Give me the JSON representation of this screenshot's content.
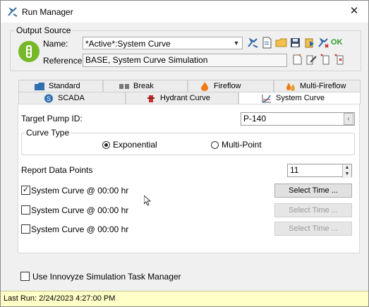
{
  "window": {
    "title": "Run Manager",
    "close_glyph": "✕"
  },
  "output_source": {
    "group_label": "Output Source",
    "name_label": "Name:",
    "name_value": "*Active*:System Curve",
    "reference_label": "Reference:",
    "reference_value": "BASE, System Curve Simulation",
    "ok_label": "OK"
  },
  "tabs": {
    "row1": [
      {
        "label": "Standard",
        "icon": "folder-icon"
      },
      {
        "label": "Break",
        "icon": "pipe-break-icon"
      },
      {
        "label": "Fireflow",
        "icon": "flame-icon"
      },
      {
        "label": "Multi-Fireflow",
        "icon": "multi-flame-icon"
      }
    ],
    "row2": [
      {
        "label": "SCADA",
        "icon": "scada-icon"
      },
      {
        "label": "Hydrant Curve",
        "icon": "hydrant-icon"
      },
      {
        "label": "System Curve",
        "icon": "system-curve-icon"
      }
    ],
    "active": "System Curve"
  },
  "panel": {
    "target_pump_label": "Target Pump ID:",
    "target_pump_value": "P-140",
    "pick_glyph": "‹",
    "curve_type_label": "Curve Type",
    "exponential_label": "Exponential",
    "multipoint_label": "Multi-Point",
    "curve_type_selected": "Exponential",
    "report_points_label": "Report Data Points",
    "report_points_value": "11",
    "rows": [
      {
        "label": "System Curve @ 00:00 hr",
        "checked": true,
        "button": "Select Time ...",
        "enabled": true
      },
      {
        "label": "System Curve @ 00:00 hr",
        "checked": false,
        "button": "Select Time ...",
        "enabled": false
      },
      {
        "label": "System Curve @ 00:00 hr",
        "checked": false,
        "button": "Select Time ...",
        "enabled": false
      }
    ]
  },
  "task_manager_label": "Use Innovyze Simulation Task Manager",
  "status": {
    "last_run": "Last Run: 2/24/2023 4:27:00 PM"
  },
  "colors": {
    "status_bg": "#ffffc8",
    "logo_green": "#77b82a",
    "ok_green": "#2e9c2e"
  }
}
